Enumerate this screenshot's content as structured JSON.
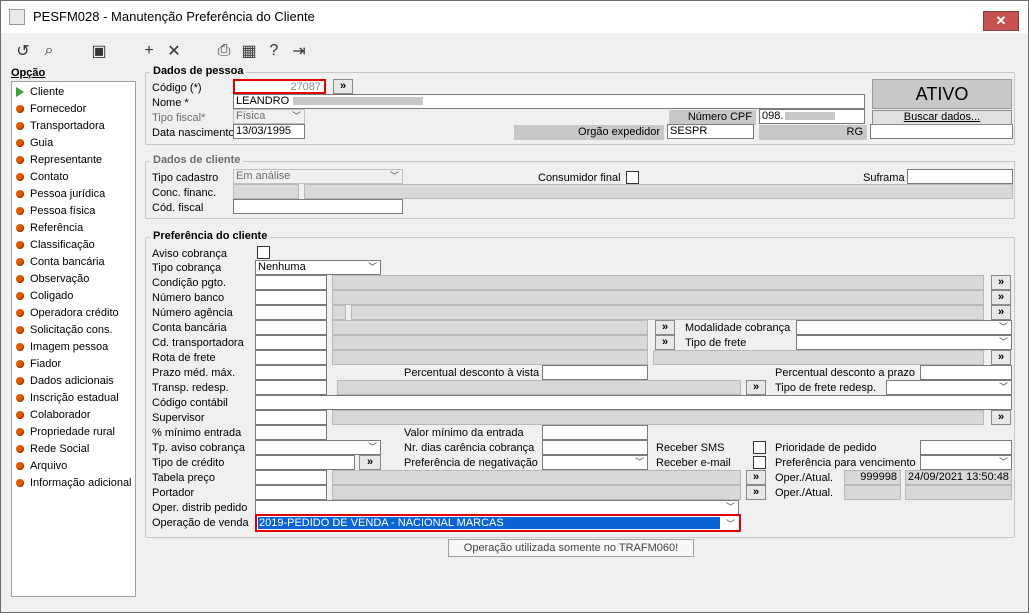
{
  "window": {
    "title": "PESFM028 - Manutenção Preferência do Cliente",
    "close_label": "✕"
  },
  "toolbar": {
    "icons": [
      "undo-icon",
      "search-icon",
      "save-icon",
      "add-icon",
      "delete-icon",
      "print-icon",
      "calendar-icon",
      "help-icon",
      "exit-icon"
    ]
  },
  "sidebar": {
    "title": "Opção",
    "items": [
      "Cliente",
      "Fornecedor",
      "Transportadora",
      "Guia",
      "Representante",
      "Contato",
      "Pessoa jurídica",
      "Pessoa física",
      "Referência",
      "Classificação",
      "Conta bancária",
      "Observação",
      "Coligado",
      "Operadora crédito",
      "Solicitação cons.",
      "Imagem pessoa",
      "Fiador",
      "Dados adicionais",
      "Inscrição estadual",
      "Colaborador",
      "Propriedade rural",
      "Rede Social",
      "Arquivo",
      "Informação adicional"
    ]
  },
  "pessoa": {
    "group_title": "Dados de pessoa",
    "codigo_label": "Código (*)",
    "codigo_value": "27087",
    "nome_label": "Nome *",
    "nome_value": "LEANDRO",
    "tipo_fiscal_label": "Tipo fiscal*",
    "tipo_fiscal_value": "Física",
    "cpf_label": "Número CPF",
    "cpf_value": "098.",
    "data_nasc_label": "Data nascimento",
    "data_nasc_value": "13/03/1995",
    "orgao_label": "Orgão expedidor",
    "orgao_value": "SESPR",
    "rg_label": "RG",
    "status": "ATIVO",
    "buscar_label": "Buscar dados...",
    "arrow": "»"
  },
  "cliente": {
    "group_title": "Dados de cliente",
    "tipo_cadastro_label": "Tipo cadastro",
    "tipo_cadastro_value": "Em análise",
    "consumidor_label": "Consumidor final",
    "suframa_label": "Suframa",
    "conc_financ_label": "Conc. financ.",
    "cod_fiscal_label": "Cód. fiscal"
  },
  "pref": {
    "group_title": "Preferência do cliente",
    "aviso_cobranca": "Aviso cobrança",
    "tipo_cobranca": "Tipo cobrança",
    "tipo_cobranca_value": "Nenhuma",
    "condicao_pgto": "Condição pgto.",
    "numero_banco": "Número banco",
    "numero_agencia": "Número agência",
    "conta_bancaria": "Conta bancária",
    "modalidade_cobranca": "Modalidade cobrança",
    "cd_transportadora": "Cd. transportadora",
    "tipo_frete": "Tipo de frete",
    "rota_frete": "Rota de frete",
    "prazo_med": "Prazo méd. máx.",
    "perc_desc_vista": "Percentual desconto à vista",
    "perc_desc_prazo": "Percentual desconto a prazo",
    "transp_redesp": "Transp. redesp.",
    "tipo_frete_redesp": "Tipo de frete redesp.",
    "codigo_contabil": "Código contábil",
    "supervisor": "Supervisor",
    "valor_min_entrada": "Valor mínimo da entrada",
    "perc_min_entrada": "% mínimo entrada",
    "tp_aviso_cobranca": "Tp. aviso cobrança",
    "nr_dias_carencia": "Nr. dias carência cobrança",
    "receber_sms": "Receber SMS",
    "prioridade_pedido": "Prioridade de pedido",
    "tipo_credito": "Tipo de crédito",
    "pref_negativacao": "Preferência de negativação",
    "receber_email": "Receber e-mail",
    "pref_vencimento": "Preferência para vencimento",
    "tabela_preco": "Tabela preço",
    "oper_atual_1": "Oper./Atual.",
    "oper_atual_1_user": "999998",
    "oper_atual_1_date": "24/09/2021 13:50:48",
    "portador": "Portador",
    "oper_atual_2": "Oper./Atual.",
    "oper_distrib": "Oper. distrib pedido",
    "operacao_venda": "Operação de venda",
    "operacao_venda_value": "2019-PEDIDO DE VENDA - NACIONAL MARCAS"
  },
  "tooltip": "Operação utilizada somente no TRAFM060!",
  "colors": {
    "accent_blue": "#0a64d6",
    "red_highlight": "#e00000",
    "status_gray": "#c8c8c8"
  }
}
